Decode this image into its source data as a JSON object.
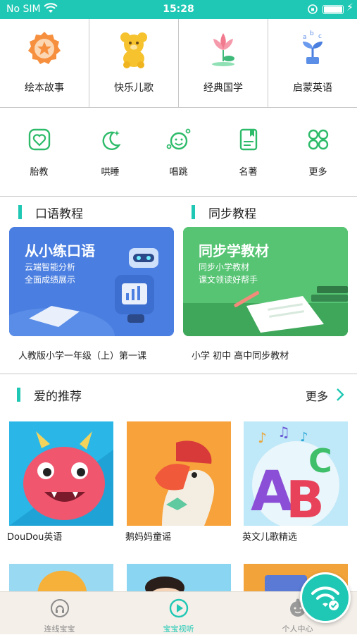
{
  "status_bar": {
    "carrier": "No SIM",
    "time": "15:28"
  },
  "top_categories": [
    {
      "label": "绘本故事",
      "icon": "star-badge-icon"
    },
    {
      "label": "快乐儿歌",
      "icon": "teddy-bear-icon"
    },
    {
      "label": "经典国学",
      "icon": "lotus-flower-icon"
    },
    {
      "label": "启蒙英语",
      "icon": "abc-sprout-icon"
    }
  ],
  "sub_categories": [
    {
      "label": "胎教",
      "icon": "heart-frame-icon"
    },
    {
      "label": "哄睡",
      "icon": "moon-stars-icon"
    },
    {
      "label": "唱跳",
      "icon": "smile-music-icon"
    },
    {
      "label": "名著",
      "icon": "book-icon"
    },
    {
      "label": "更多",
      "icon": "four-petal-icon"
    }
  ],
  "courses": {
    "oral": {
      "title": "口语教程",
      "card_title": "从小练口语",
      "card_sub1": "云端智能分析",
      "card_sub2": "全面成绩展示",
      "caption": "人教版小学一年级（上）第一课"
    },
    "sync": {
      "title": "同步教程",
      "card_title": "同步学教材",
      "card_sub1": "同步小学教材",
      "card_sub2": "课文领读好帮手",
      "caption": "小学 初中 高中同步教材"
    }
  },
  "recommend": {
    "title": "爱的推荐",
    "more": "更多",
    "items": [
      {
        "label": "DouDou英语"
      },
      {
        "label": "鹅妈妈童谣"
      },
      {
        "label": "英文儿歌精选"
      }
    ]
  },
  "tabbar": {
    "tabs": [
      {
        "label": "连线宝宝",
        "icon": "connect-baby-icon",
        "active": false
      },
      {
        "label": "宝宝视听",
        "icon": "play-circle-icon",
        "active": true
      },
      {
        "label": "个人中心",
        "icon": "user-face-icon",
        "active": false
      }
    ]
  },
  "colors": {
    "accent": "#1fc8b4",
    "tab_active": "#1fc8b4",
    "tab_inactive": "#8a8a8a"
  }
}
